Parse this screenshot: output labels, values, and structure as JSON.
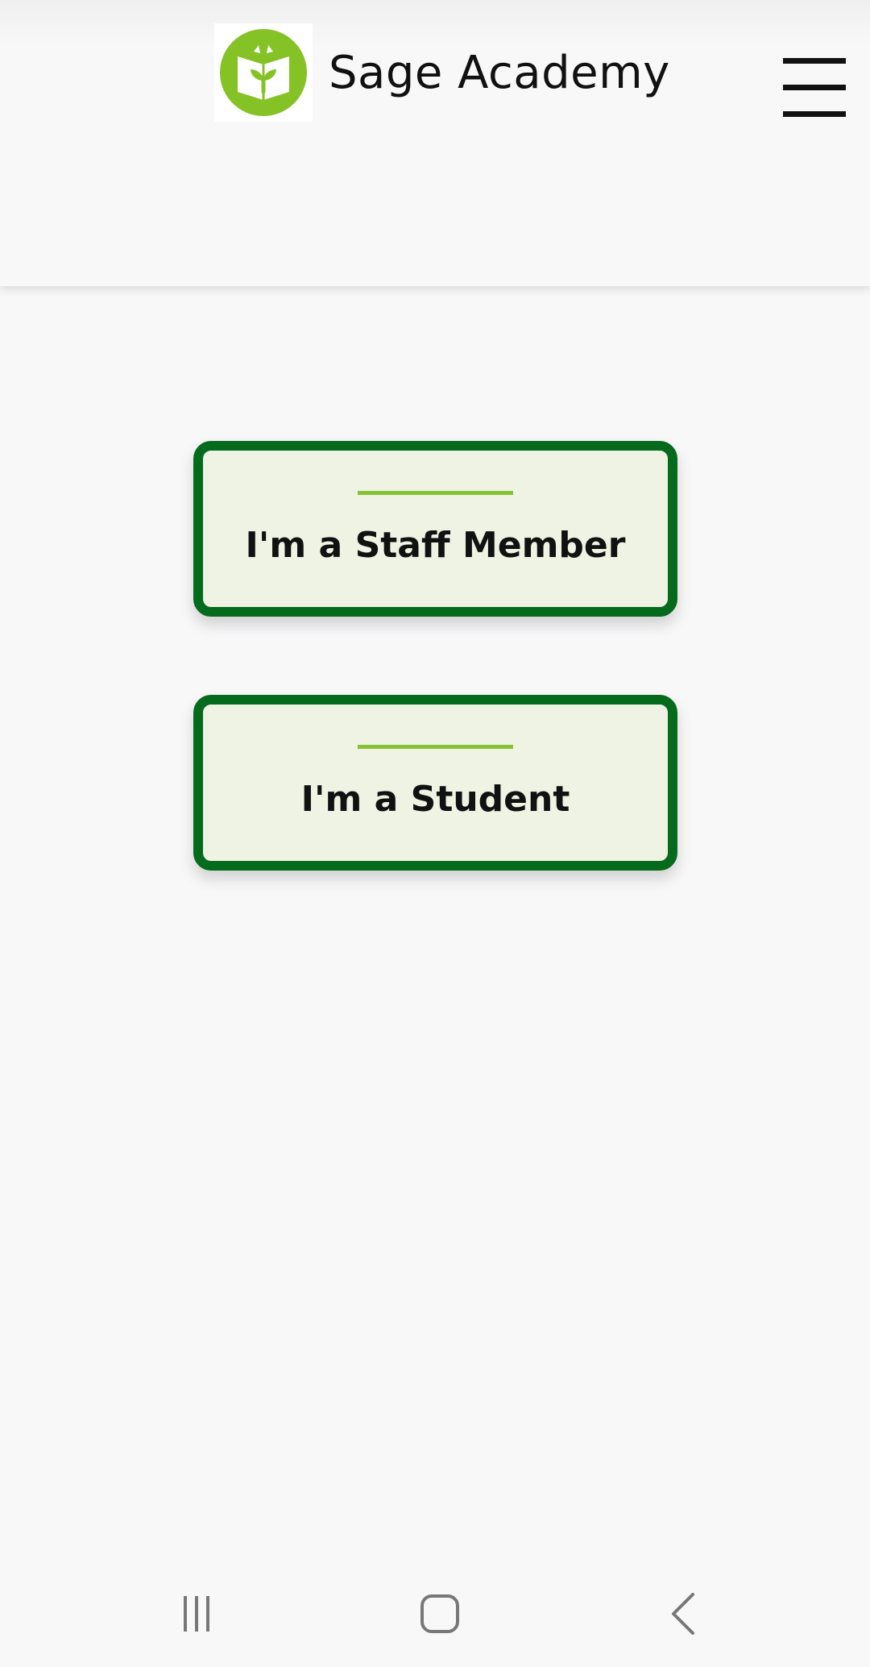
{
  "app": {
    "name": "Sage Academy",
    "logo_icon": "open-book-sprout-icon",
    "brand_color": "#84c225"
  },
  "header": {
    "menu_icon": "hamburger-menu-icon"
  },
  "roles": [
    {
      "label": "I'm a Staff Member"
    },
    {
      "label": "I'm a Student"
    }
  ],
  "colors": {
    "card_border": "#056b1c",
    "card_background": "#eef3e4",
    "card_accent": "#86c334",
    "page_background": "#f8f8f9"
  },
  "system_nav": {
    "buttons": [
      "recents-icon",
      "home-icon",
      "back-icon"
    ]
  }
}
